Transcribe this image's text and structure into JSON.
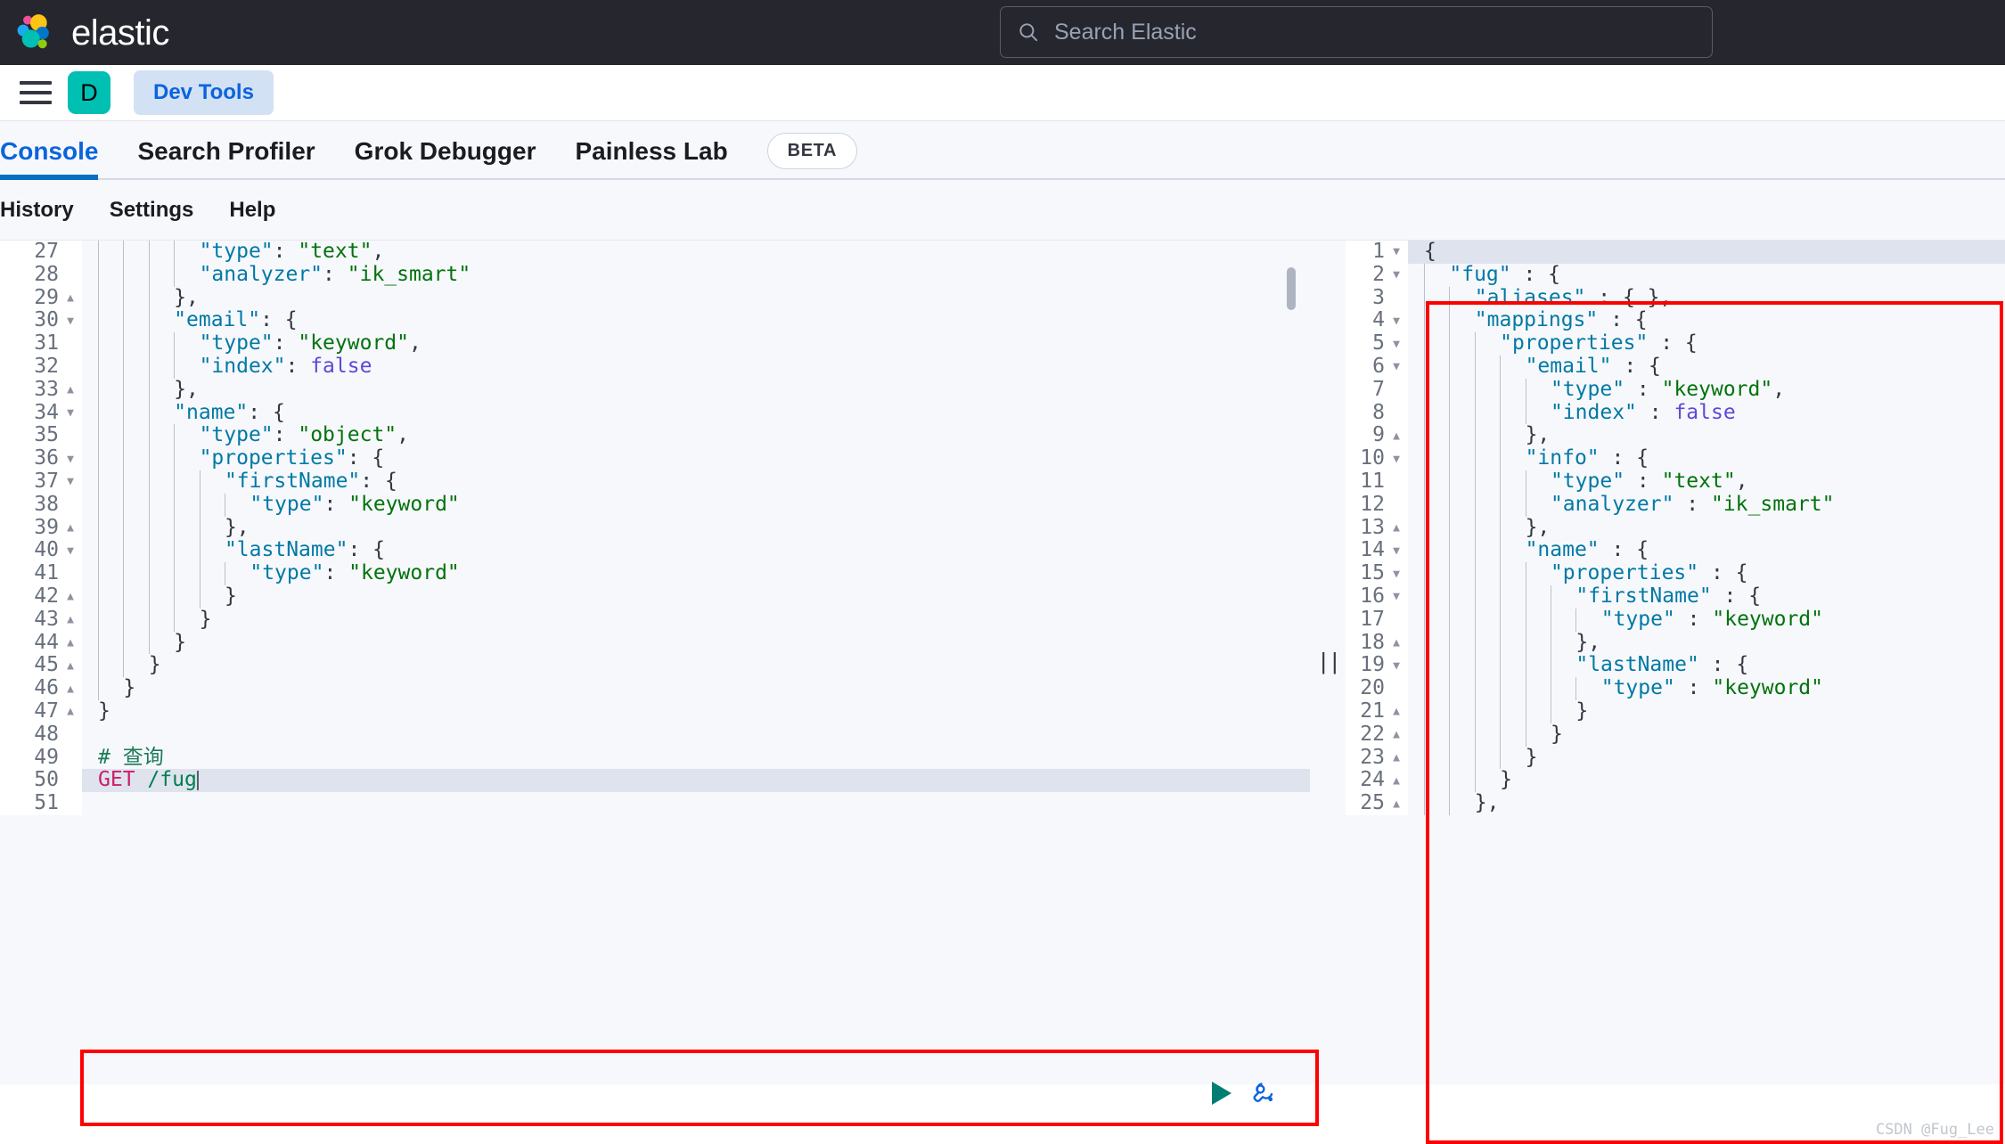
{
  "header": {
    "brand": "elastic",
    "logo_icon": "elastic-logo",
    "search": {
      "icon": "search-icon",
      "placeholder": "Search Elastic",
      "value": ""
    }
  },
  "navbar": {
    "menu_icon": "hamburger-menu-icon",
    "space_avatar": "D",
    "breadcrumb": "Dev Tools"
  },
  "apptabs": {
    "items": [
      {
        "label": "Console",
        "active": true
      },
      {
        "label": "Search Profiler",
        "active": false
      },
      {
        "label": "Grok Debugger",
        "active": false
      },
      {
        "label": "Painless Lab",
        "active": false
      }
    ],
    "badge": "BETA",
    "accent": "#0b64dd",
    "underline": "#0b6ec2"
  },
  "submenu": {
    "items": [
      "History",
      "Settings",
      "Help"
    ]
  },
  "editor": {
    "gutter_start": 27,
    "actions": {
      "run_icon": "play-icon",
      "wrench_icon": "wrench-icon"
    },
    "scrollbar": "vertical-scrollbar-thumb",
    "lines": [
      {
        "n": 27,
        "fold": "",
        "indent": 4,
        "hl": false,
        "tokens": [
          {
            "t": "\"type\"",
            "c": "k"
          },
          {
            "t": ": ",
            "c": "p"
          },
          {
            "t": "\"text\"",
            "c": "s"
          },
          {
            "t": ",",
            "c": "p"
          }
        ]
      },
      {
        "n": 28,
        "fold": "",
        "indent": 4,
        "hl": false,
        "tokens": [
          {
            "t": "\"analyzer\"",
            "c": "k"
          },
          {
            "t": ": ",
            "c": "p"
          },
          {
            "t": "\"ik_smart\"",
            "c": "s"
          }
        ]
      },
      {
        "n": 29,
        "fold": "up",
        "indent": 3,
        "hl": false,
        "tokens": [
          {
            "t": "},",
            "c": "p"
          }
        ]
      },
      {
        "n": 30,
        "fold": "down",
        "indent": 3,
        "hl": false,
        "tokens": [
          {
            "t": "\"email\"",
            "c": "k"
          },
          {
            "t": ": {",
            "c": "p"
          }
        ]
      },
      {
        "n": 31,
        "fold": "",
        "indent": 4,
        "hl": false,
        "tokens": [
          {
            "t": "\"type\"",
            "c": "k"
          },
          {
            "t": ": ",
            "c": "p"
          },
          {
            "t": "\"keyword\"",
            "c": "s"
          },
          {
            "t": ",",
            "c": "p"
          }
        ]
      },
      {
        "n": 32,
        "fold": "",
        "indent": 4,
        "hl": false,
        "tokens": [
          {
            "t": "\"index\"",
            "c": "k"
          },
          {
            "t": ": ",
            "c": "p"
          },
          {
            "t": "false",
            "c": "b"
          }
        ]
      },
      {
        "n": 33,
        "fold": "up",
        "indent": 3,
        "hl": false,
        "tokens": [
          {
            "t": "},",
            "c": "p"
          }
        ]
      },
      {
        "n": 34,
        "fold": "down",
        "indent": 3,
        "hl": false,
        "tokens": [
          {
            "t": "\"name\"",
            "c": "k"
          },
          {
            "t": ": {",
            "c": "p"
          }
        ]
      },
      {
        "n": 35,
        "fold": "",
        "indent": 4,
        "hl": false,
        "tokens": [
          {
            "t": "\"type\"",
            "c": "k"
          },
          {
            "t": ": ",
            "c": "p"
          },
          {
            "t": "\"object\"",
            "c": "s"
          },
          {
            "t": ",",
            "c": "p"
          }
        ]
      },
      {
        "n": 36,
        "fold": "down",
        "indent": 4,
        "hl": false,
        "tokens": [
          {
            "t": "\"properties\"",
            "c": "k"
          },
          {
            "t": ": {",
            "c": "p"
          }
        ]
      },
      {
        "n": 37,
        "fold": "down",
        "indent": 5,
        "hl": false,
        "tokens": [
          {
            "t": "\"firstName\"",
            "c": "k"
          },
          {
            "t": ": {",
            "c": "p"
          }
        ]
      },
      {
        "n": 38,
        "fold": "",
        "indent": 6,
        "hl": false,
        "tokens": [
          {
            "t": "\"type\"",
            "c": "k"
          },
          {
            "t": ": ",
            "c": "p"
          },
          {
            "t": "\"keyword\"",
            "c": "s"
          }
        ]
      },
      {
        "n": 39,
        "fold": "up",
        "indent": 5,
        "hl": false,
        "tokens": [
          {
            "t": "},",
            "c": "p"
          }
        ]
      },
      {
        "n": 40,
        "fold": "down",
        "indent": 5,
        "hl": false,
        "tokens": [
          {
            "t": "\"lastName\"",
            "c": "k"
          },
          {
            "t": ": {",
            "c": "p"
          }
        ]
      },
      {
        "n": 41,
        "fold": "",
        "indent": 6,
        "hl": false,
        "tokens": [
          {
            "t": "\"type\"",
            "c": "k"
          },
          {
            "t": ": ",
            "c": "p"
          },
          {
            "t": "\"keyword\"",
            "c": "s"
          }
        ]
      },
      {
        "n": 42,
        "fold": "up",
        "indent": 5,
        "hl": false,
        "tokens": [
          {
            "t": "}",
            "c": "p"
          }
        ]
      },
      {
        "n": 43,
        "fold": "up",
        "indent": 4,
        "hl": false,
        "tokens": [
          {
            "t": "}",
            "c": "p"
          }
        ]
      },
      {
        "n": 44,
        "fold": "up",
        "indent": 3,
        "hl": false,
        "tokens": [
          {
            "t": "}",
            "c": "p"
          }
        ]
      },
      {
        "n": 45,
        "fold": "up",
        "indent": 2,
        "hl": false,
        "tokens": [
          {
            "t": "}",
            "c": "p"
          }
        ]
      },
      {
        "n": 46,
        "fold": "up",
        "indent": 1,
        "hl": false,
        "tokens": [
          {
            "t": "}",
            "c": "p"
          }
        ]
      },
      {
        "n": 47,
        "fold": "up",
        "indent": 0,
        "hl": false,
        "tokens": [
          {
            "t": "}",
            "c": "p"
          }
        ]
      },
      {
        "n": 48,
        "fold": "",
        "indent": 0,
        "hl": false,
        "tokens": []
      },
      {
        "n": 49,
        "fold": "",
        "indent": 0,
        "hl": false,
        "tokens": [
          {
            "t": "# 查询",
            "c": "cm"
          }
        ]
      },
      {
        "n": 50,
        "fold": "",
        "indent": 0,
        "hl": true,
        "tokens": [
          {
            "t": "GET",
            "c": "mth"
          },
          {
            "t": " ",
            "c": "p"
          },
          {
            "t": "/fug",
            "c": "url"
          }
        ],
        "caret": true
      },
      {
        "n": 51,
        "fold": "",
        "indent": 0,
        "hl": false,
        "tokens": []
      }
    ]
  },
  "response": {
    "lines": [
      {
        "n": 1,
        "fold": "down",
        "indent": 0,
        "hl": true,
        "tokens": [
          {
            "t": "{",
            "c": "p"
          }
        ]
      },
      {
        "n": 2,
        "fold": "down",
        "indent": 1,
        "hl": false,
        "tokens": [
          {
            "t": "\"fug\"",
            "c": "k"
          },
          {
            "t": " : {",
            "c": "p"
          }
        ]
      },
      {
        "n": 3,
        "fold": "",
        "indent": 2,
        "hl": false,
        "tokens": [
          {
            "t": "\"aliases\"",
            "c": "k"
          },
          {
            "t": " : { },",
            "c": "p"
          }
        ]
      },
      {
        "n": 4,
        "fold": "down",
        "indent": 2,
        "hl": false,
        "tokens": [
          {
            "t": "\"mappings\"",
            "c": "k"
          },
          {
            "t": " : {",
            "c": "p"
          }
        ]
      },
      {
        "n": 5,
        "fold": "down",
        "indent": 3,
        "hl": false,
        "tokens": [
          {
            "t": "\"properties\"",
            "c": "k"
          },
          {
            "t": " : {",
            "c": "p"
          }
        ]
      },
      {
        "n": 6,
        "fold": "down",
        "indent": 4,
        "hl": false,
        "tokens": [
          {
            "t": "\"email\"",
            "c": "k"
          },
          {
            "t": " : {",
            "c": "p"
          }
        ]
      },
      {
        "n": 7,
        "fold": "",
        "indent": 5,
        "hl": false,
        "tokens": [
          {
            "t": "\"type\"",
            "c": "k"
          },
          {
            "t": " : ",
            "c": "p"
          },
          {
            "t": "\"keyword\"",
            "c": "s"
          },
          {
            "t": ",",
            "c": "p"
          }
        ]
      },
      {
        "n": 8,
        "fold": "",
        "indent": 5,
        "hl": false,
        "tokens": [
          {
            "t": "\"index\"",
            "c": "k"
          },
          {
            "t": " : ",
            "c": "p"
          },
          {
            "t": "false",
            "c": "b"
          }
        ]
      },
      {
        "n": 9,
        "fold": "up",
        "indent": 4,
        "hl": false,
        "tokens": [
          {
            "t": "},",
            "c": "p"
          }
        ]
      },
      {
        "n": 10,
        "fold": "down",
        "indent": 4,
        "hl": false,
        "tokens": [
          {
            "t": "\"info\"",
            "c": "k"
          },
          {
            "t": " : {",
            "c": "p"
          }
        ]
      },
      {
        "n": 11,
        "fold": "",
        "indent": 5,
        "hl": false,
        "tokens": [
          {
            "t": "\"type\"",
            "c": "k"
          },
          {
            "t": " : ",
            "c": "p"
          },
          {
            "t": "\"text\"",
            "c": "s"
          },
          {
            "t": ",",
            "c": "p"
          }
        ]
      },
      {
        "n": 12,
        "fold": "",
        "indent": 5,
        "hl": false,
        "tokens": [
          {
            "t": "\"analyzer\"",
            "c": "k"
          },
          {
            "t": " : ",
            "c": "p"
          },
          {
            "t": "\"ik_smart\"",
            "c": "s"
          }
        ]
      },
      {
        "n": 13,
        "fold": "up",
        "indent": 4,
        "hl": false,
        "tokens": [
          {
            "t": "},",
            "c": "p"
          }
        ]
      },
      {
        "n": 14,
        "fold": "down",
        "indent": 4,
        "hl": false,
        "tokens": [
          {
            "t": "\"name\"",
            "c": "k"
          },
          {
            "t": " : {",
            "c": "p"
          }
        ]
      },
      {
        "n": 15,
        "fold": "down",
        "indent": 5,
        "hl": false,
        "tokens": [
          {
            "t": "\"properties\"",
            "c": "k"
          },
          {
            "t": " : {",
            "c": "p"
          }
        ]
      },
      {
        "n": 16,
        "fold": "down",
        "indent": 6,
        "hl": false,
        "tokens": [
          {
            "t": "\"firstName\"",
            "c": "k"
          },
          {
            "t": " : {",
            "c": "p"
          }
        ]
      },
      {
        "n": 17,
        "fold": "",
        "indent": 7,
        "hl": false,
        "tokens": [
          {
            "t": "\"type\"",
            "c": "k"
          },
          {
            "t": " : ",
            "c": "p"
          },
          {
            "t": "\"keyword\"",
            "c": "s"
          }
        ]
      },
      {
        "n": 18,
        "fold": "up",
        "indent": 6,
        "hl": false,
        "tokens": [
          {
            "t": "},",
            "c": "p"
          }
        ]
      },
      {
        "n": 19,
        "fold": "down",
        "indent": 6,
        "hl": false,
        "tokens": [
          {
            "t": "\"lastName\"",
            "c": "k"
          },
          {
            "t": " : {",
            "c": "p"
          }
        ]
      },
      {
        "n": 20,
        "fold": "",
        "indent": 7,
        "hl": false,
        "tokens": [
          {
            "t": "\"type\"",
            "c": "k"
          },
          {
            "t": " : ",
            "c": "p"
          },
          {
            "t": "\"keyword\"",
            "c": "s"
          }
        ]
      },
      {
        "n": 21,
        "fold": "up",
        "indent": 6,
        "hl": false,
        "tokens": [
          {
            "t": "}",
            "c": "p"
          }
        ]
      },
      {
        "n": 22,
        "fold": "up",
        "indent": 5,
        "hl": false,
        "tokens": [
          {
            "t": "}",
            "c": "p"
          }
        ]
      },
      {
        "n": 23,
        "fold": "up",
        "indent": 4,
        "hl": false,
        "tokens": [
          {
            "t": "}",
            "c": "p"
          }
        ]
      },
      {
        "n": 24,
        "fold": "up",
        "indent": 3,
        "hl": false,
        "tokens": [
          {
            "t": "}",
            "c": "p"
          }
        ]
      },
      {
        "n": 25,
        "fold": "up",
        "indent": 2,
        "hl": false,
        "tokens": [
          {
            "t": "},",
            "c": "p"
          }
        ]
      }
    ]
  },
  "annotations": {
    "request_box_color": "#ff0000",
    "response_box_color": "#ff0000"
  },
  "watermark": "CSDN @Fug_Lee"
}
